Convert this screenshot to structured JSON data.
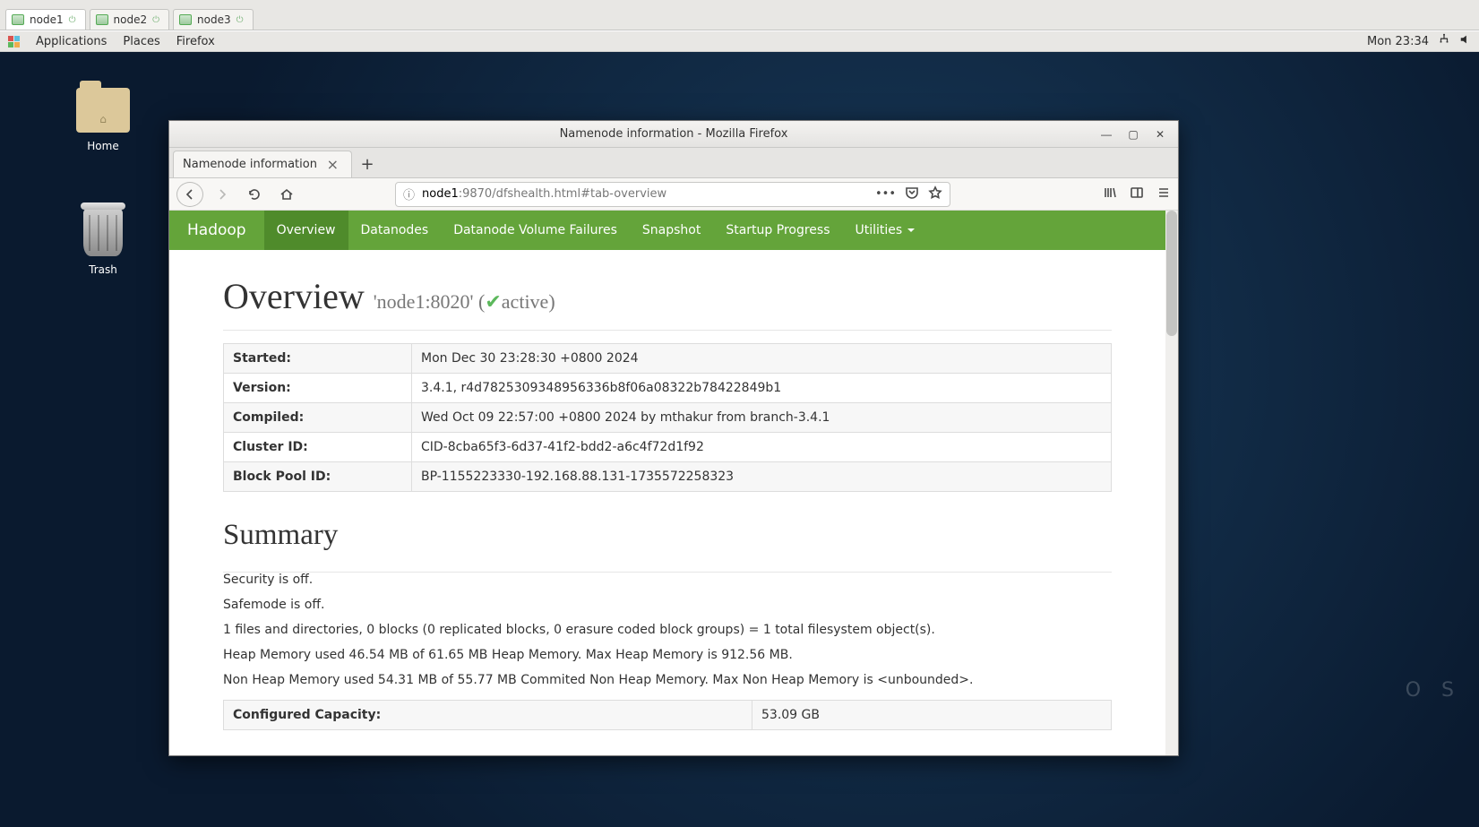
{
  "vm_tabs": {
    "active": "node1",
    "items": [
      "node1",
      "node2",
      "node3"
    ]
  },
  "gnome": {
    "apps": "Applications",
    "places": "Places",
    "firefox": "Firefox",
    "clock": "Mon 23:34"
  },
  "desktop": {
    "home": "Home",
    "trash": "Trash",
    "os_mark": "O S"
  },
  "firefox": {
    "title": "Namenode information - Mozilla Firefox",
    "tab_label": "Namenode information",
    "url_host": "node1",
    "url_rest": ":9870/dfshealth.html#tab-overview",
    "url_more": "•••"
  },
  "nav": {
    "brand": "Hadoop",
    "items": [
      "Overview",
      "Datanodes",
      "Datanode Volume Failures",
      "Snapshot",
      "Startup Progress",
      "Utilities"
    ],
    "active": "Overview"
  },
  "overview": {
    "heading": "Overview",
    "host": "'node1:8020'",
    "status": "active",
    "rows": [
      {
        "label": "Started:",
        "value": "Mon Dec 30 23:28:30 +0800 2024"
      },
      {
        "label": "Version:",
        "value": "3.4.1, r4d7825309348956336b8f06a08322b78422849b1"
      },
      {
        "label": "Compiled:",
        "value": "Wed Oct 09 22:57:00 +0800 2024 by mthakur from branch-3.4.1"
      },
      {
        "label": "Cluster ID:",
        "value": "CID-8cba65f3-6d37-41f2-bdd2-a6c4f72d1f92"
      },
      {
        "label": "Block Pool ID:",
        "value": "BP-1155223330-192.168.88.131-1735572258323"
      }
    ]
  },
  "summary": {
    "heading": "Summary",
    "lines": [
      "Security is off.",
      "Safemode is off.",
      "1 files and directories, 0 blocks (0 replicated blocks, 0 erasure coded block groups) = 1 total filesystem object(s).",
      "Heap Memory used 46.54 MB of 61.65 MB Heap Memory. Max Heap Memory is 912.56 MB.",
      "Non Heap Memory used 54.31 MB of 55.77 MB Commited Non Heap Memory. Max Non Heap Memory is <unbounded>."
    ],
    "rows": [
      {
        "label": "Configured Capacity:",
        "value": "53.09 GB"
      }
    ]
  }
}
